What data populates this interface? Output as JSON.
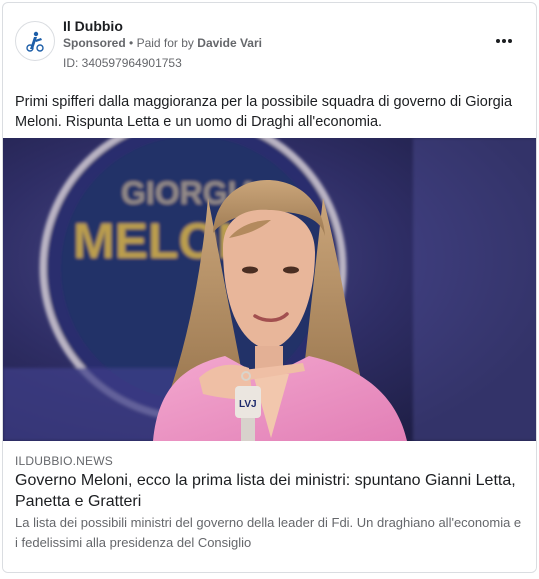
{
  "ad": {
    "page_name": "Il Dubbio",
    "sponsored_label": "Sponsored",
    "separator": "•",
    "paid_for_prefix": "Paid for by",
    "paid_for_name": "Davide Vari",
    "ad_id": "ID: 340597964901753",
    "more_icon": "more-horizontal-icon",
    "body_text": "Primi spifferi dalla maggioranza per la possibile squadra di governo di Giorgia Meloni. Rispunta Letta e un uomo di Draghi all'economia."
  },
  "media": {
    "backdrop_line1": "GIORGIA",
    "backdrop_line2": "MELONI",
    "mic_label": "LVJ"
  },
  "link_preview": {
    "domain": "ILDUBBIO.NEWS",
    "headline": "Governo Meloni, ecco la prima lista dei ministri: spuntano Gianni Letta, Panetta e Gratteri",
    "description": "La lista dei possibili ministri del governo della leader di Fdi. Un draghiano all'economia e i fedelissimi alla presidenza del Consiglio"
  },
  "colors": {
    "primary_text": "#1c1e21",
    "secondary_text": "#65676b",
    "border": "#dadde1",
    "brand_blue": "#1d5ea8"
  }
}
